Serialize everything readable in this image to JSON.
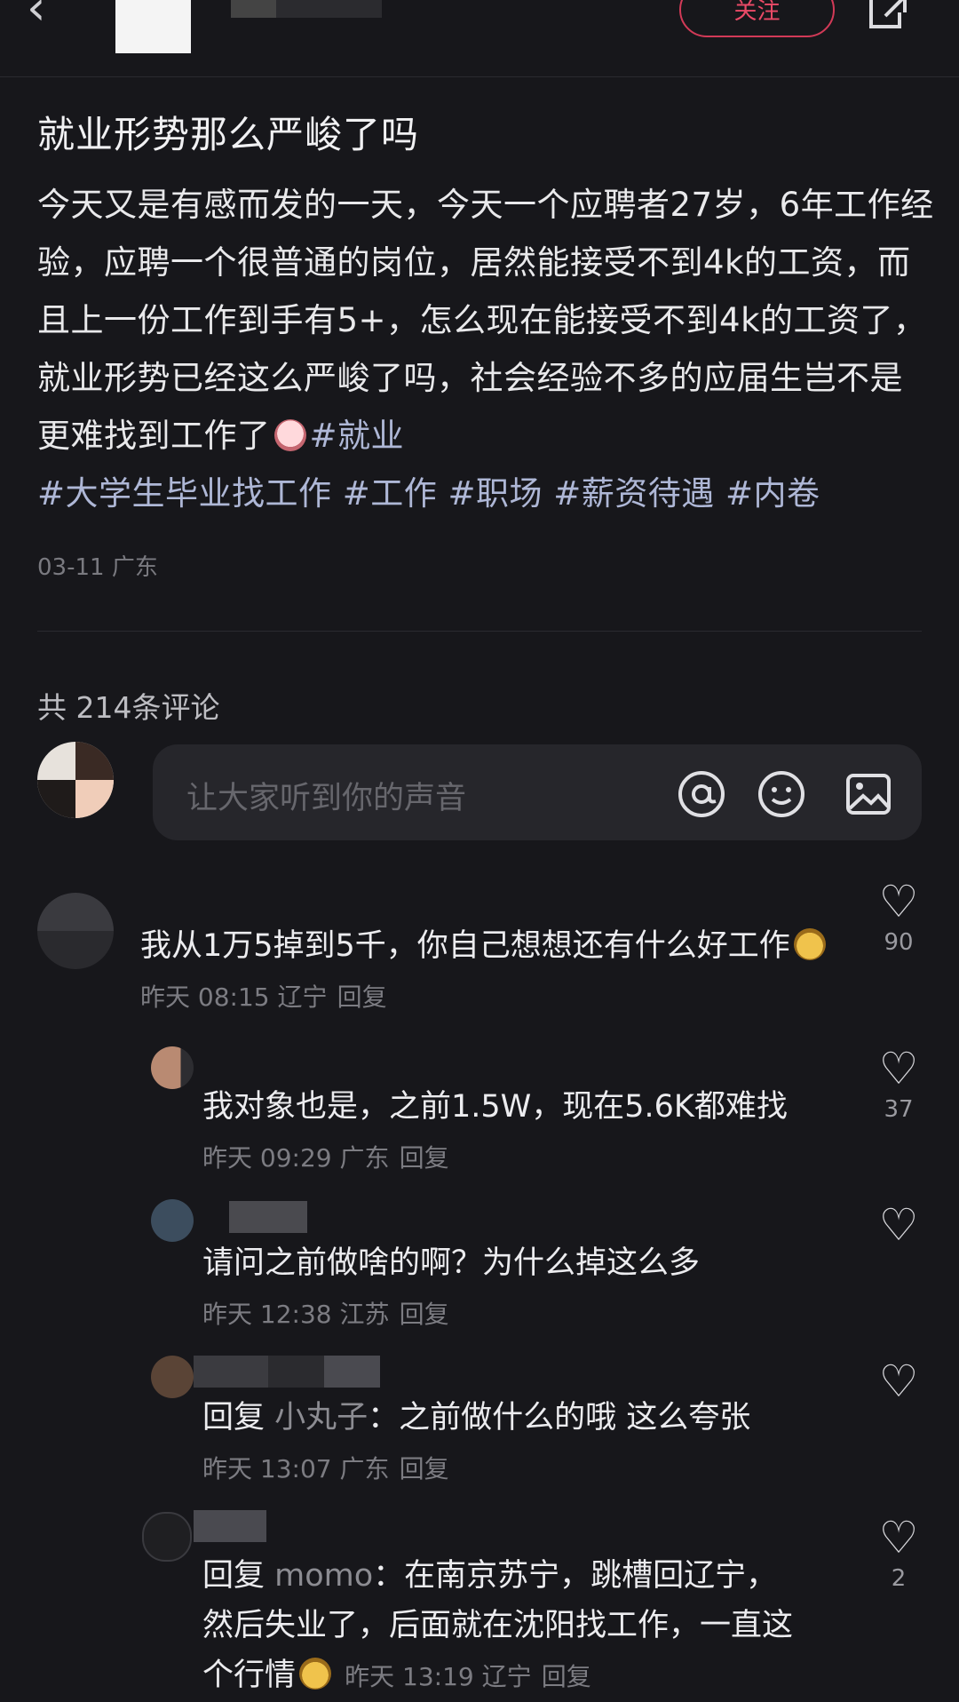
{
  "header": {
    "follow_label": "关注"
  },
  "post": {
    "title": "就业形势那么严峻了吗",
    "body_text": "今天又是有感而发的一天，今天一个应聘者27岁，6年工作经验，应聘一个很普通的岗位，居然能接受不到4k的工资，而且上一份工作到手有5+，怎么现在能接受不到4k的工资了，就业形势已经这么严峻了吗，社会经验不多的应届生岂不是更难找到工作了",
    "tags_inline": "#就业",
    "tags_line": "#大学生毕业找工作 #工作 #职场 #薪资待遇 #内卷",
    "meta": "03-11 广东"
  },
  "comments_header": {
    "count_text": "共 214条评论",
    "input_placeholder": "让大家听到你的声音"
  },
  "comments": [
    {
      "text": "我从1万5掉到5千，你自己想想还有什么好工作",
      "meta": "昨天 08:15 辽宁",
      "reply": "回复",
      "likes": "90"
    },
    {
      "text": "我对象也是，之前1.5W，现在5.6K都难找",
      "meta": "昨天 09:29 广东",
      "reply": "回复",
      "likes": "37"
    },
    {
      "text": "请问之前做啥的啊？为什么掉这么多",
      "meta": "昨天 12:38 江苏",
      "reply": "回复",
      "likes": ""
    },
    {
      "prefix": "回复",
      "ref": "小丸子",
      "text": "：之前做什么的哦 这么夸张",
      "meta": "昨天 13:07 广东",
      "reply": "回复",
      "likes": ""
    },
    {
      "prefix": "回复",
      "ref": "momo",
      "text": "：在南京苏宁，跳槽回辽宁，然后失业了，后面就在沈阳找工作，一直这个行情",
      "meta": "昨天 13:19 辽宁",
      "reply": "回复",
      "likes": "2"
    }
  ],
  "icons": {
    "back": "chevron-left-icon",
    "share": "share-icon",
    "at": "at-icon",
    "emoji": "emoji-icon",
    "image": "image-icon",
    "like": "heart-icon"
  }
}
